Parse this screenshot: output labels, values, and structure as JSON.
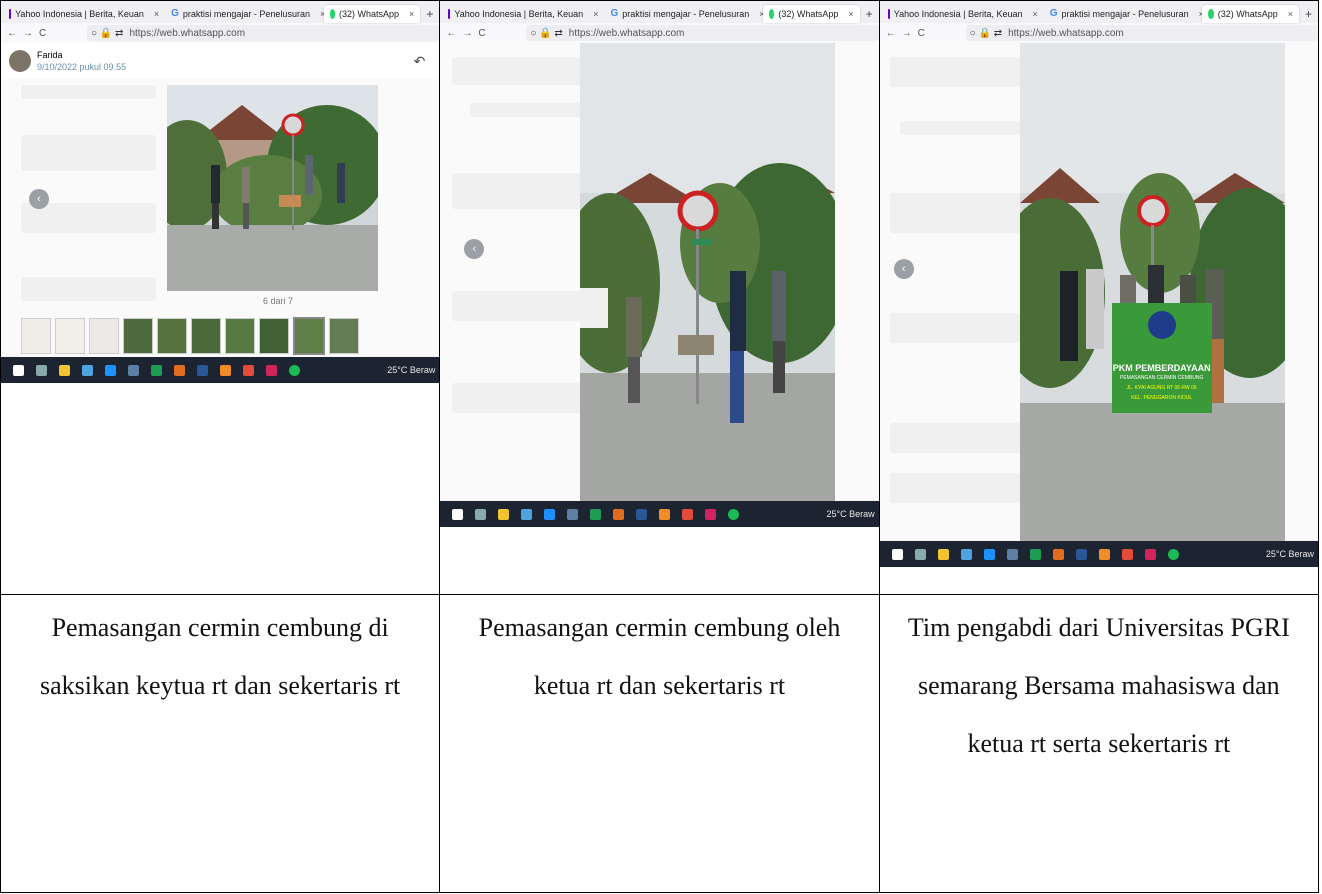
{
  "browser": {
    "tabs": [
      {
        "label": "Yahoo Indonesia | Berita, Keuan",
        "icon": "yahoo-favicon"
      },
      {
        "label": "praktisi mengajar - Penelusuran",
        "icon": "google-favicon"
      },
      {
        "label": "(32) WhatsApp",
        "icon": "whatsapp-favicon"
      }
    ],
    "url": "https://web.whatsapp.com",
    "new_tab_symbol": "+",
    "close_symbol": "×"
  },
  "viewer": {
    "sender_name": "Farida",
    "sender_time": "9/10/2022 pukul 09.55",
    "counter": "6 dari 7"
  },
  "taskbar": {
    "weather": "25°C Beraw"
  },
  "captions": [
    "Pemasangan cermin cembung di saksikan keytua rt dan sekertaris rt",
    "Pemasangan cermin cembung oleh ketua rt dan sekertaris rt",
    "Tim pengabdi dari Universitas PGRI semarang Bersama mahasiswa dan ketua rt serta sekertaris rt"
  ],
  "banner": {
    "line1": "PKM PEMBERDAYAAN",
    "line2": "PEMASANGAN CERMIN CEMBUNG",
    "line3": "JL. KYAI AGUNG RT 06 RW 05",
    "line4": "KEL. PENGGARON KIDUL"
  },
  "colors": {
    "taskbar": "#1b2430",
    "whatsapp": "#25d366",
    "yahoo": "#6001d2",
    "banner": "#3a9a3a"
  }
}
